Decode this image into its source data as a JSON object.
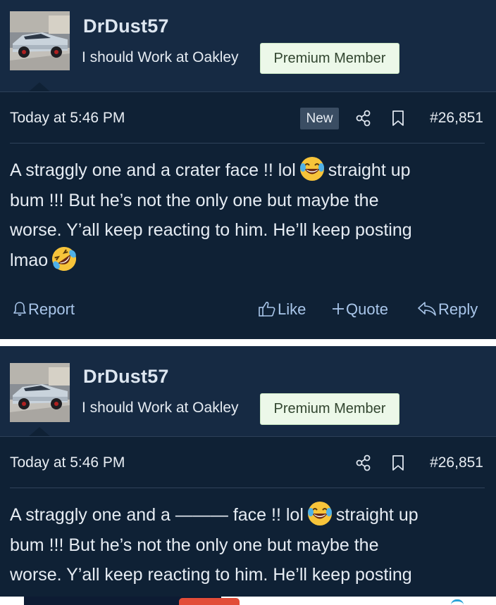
{
  "posts": [
    {
      "username": "DrDust57",
      "user_title": "I should Work at Oakley",
      "badge": "Premium Member",
      "date": "Today at 5:46 PM",
      "new_label": "New",
      "post_number": "#26,851",
      "message": {
        "line1_a": "A straggly one and a crater face !! lol",
        "line1_b": "straight up",
        "line2": "bum !!! But he’s not the only one but maybe the",
        "line3": "worse. Y’all keep reacting to him. He’ll keep posting",
        "line4": "lmao",
        "emoji_1": "face-with-tears-of-joy-icon",
        "emoji_2": "rolling-on-floor-laughing-icon"
      },
      "actions": {
        "report": "Report",
        "like": "Like",
        "quote": "Quote",
        "reply": "Reply"
      }
    },
    {
      "username": "DrDust57",
      "user_title": "I should Work at Oakley",
      "badge": "Premium Member",
      "date": "Today at 5:46 PM",
      "post_number": "#26,851",
      "message": {
        "line1_a": "A straggly one and a ——— face !! lol",
        "line1_b": "straight up",
        "line2": "bum !!! But he’s not the only one but maybe the",
        "line3": "worse. Y’all keep reacting to him. He’ll keep posting"
      }
    }
  ],
  "colors": {
    "header_bg": "#162a43",
    "body_bg": "#0f2135",
    "badge_bg": "#ecf8e9",
    "action_link": "#a9c6ea"
  }
}
